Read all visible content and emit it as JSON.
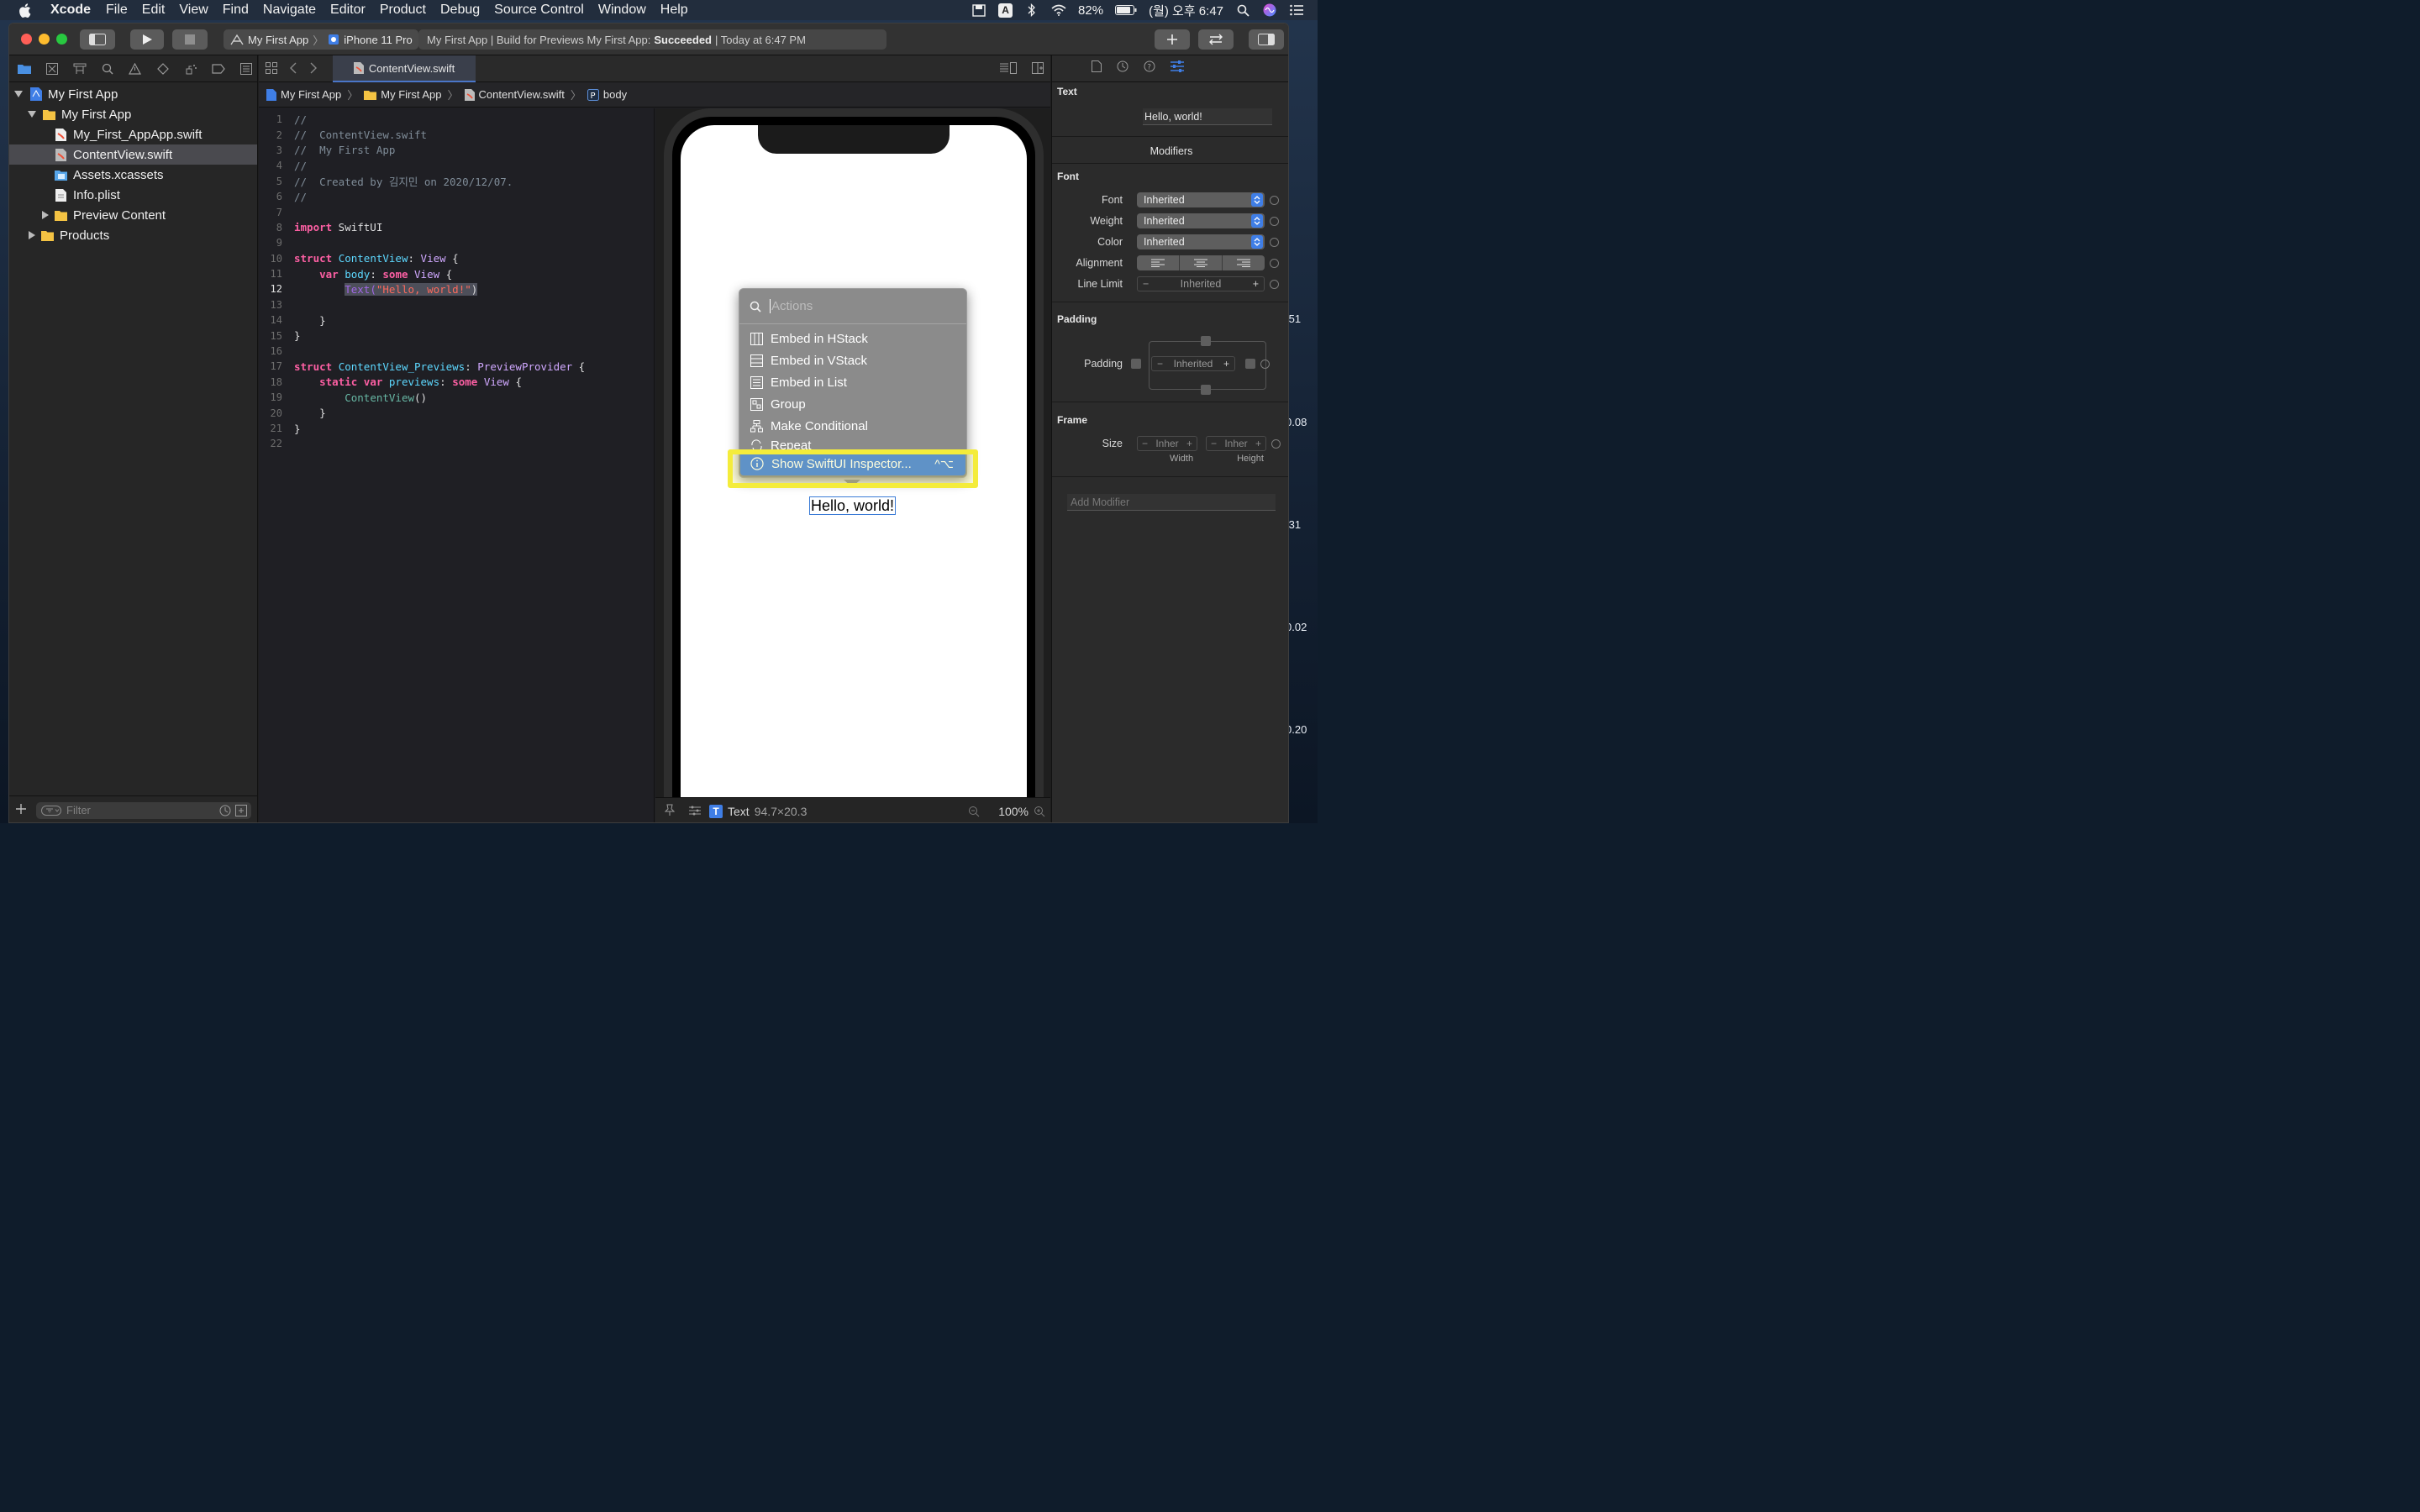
{
  "menubar": {
    "app_name": "Xcode",
    "items": [
      "File",
      "Edit",
      "View",
      "Find",
      "Navigate",
      "Editor",
      "Product",
      "Debug",
      "Source Control",
      "Window",
      "Help"
    ],
    "battery": "82%",
    "clock": "(월) 오후 6:47",
    "input_badge": "A"
  },
  "toolbar": {
    "scheme_name": "My First App",
    "device_name": "iPhone 11 Pro",
    "status_prefix": "My First App | Build for Previews My First App:",
    "status_result": "Succeeded",
    "status_time": "| Today at 6:47 PM"
  },
  "navigator": {
    "tree": [
      {
        "label": "My First App",
        "kind": "project"
      },
      {
        "label": "My First App",
        "kind": "folder"
      },
      {
        "label": "My_First_AppApp.swift",
        "kind": "swift"
      },
      {
        "label": "ContentView.swift",
        "kind": "swift",
        "selected": true
      },
      {
        "label": "Assets.xcassets",
        "kind": "assets"
      },
      {
        "label": "Info.plist",
        "kind": "plist"
      },
      {
        "label": "Preview Content",
        "kind": "folder"
      },
      {
        "label": "Products",
        "kind": "folder"
      }
    ],
    "filter_placeholder": "Filter"
  },
  "editor": {
    "tab_label": "ContentView.swift",
    "jumpbar": [
      "My First App",
      "My First App",
      "ContentView.swift",
      "body"
    ],
    "code_lines": [
      {
        "n": "1",
        "tokens": [
          [
            "c",
            "//"
          ]
        ]
      },
      {
        "n": "2",
        "tokens": [
          [
            "c",
            "//  ContentView.swift"
          ]
        ]
      },
      {
        "n": "3",
        "tokens": [
          [
            "c",
            "//  My First App"
          ]
        ]
      },
      {
        "n": "4",
        "tokens": [
          [
            "c",
            "//"
          ]
        ]
      },
      {
        "n": "5",
        "tokens": [
          [
            "c",
            "//  Created by 김지민 on 2020/12/07."
          ]
        ]
      },
      {
        "n": "6",
        "tokens": [
          [
            "c",
            "//"
          ]
        ]
      },
      {
        "n": "7",
        "tokens": []
      },
      {
        "n": "8",
        "tokens": [
          [
            "k",
            "import"
          ],
          [
            "d",
            " SwiftUI"
          ]
        ]
      },
      {
        "n": "9",
        "tokens": []
      },
      {
        "n": "10",
        "tokens": [
          [
            "k",
            "struct"
          ],
          [
            "d",
            " "
          ],
          [
            "t",
            "ContentView"
          ],
          [
            "d",
            ": "
          ],
          [
            "p",
            "View"
          ],
          [
            "d",
            " {"
          ]
        ]
      },
      {
        "n": "11",
        "tokens": [
          [
            "d",
            "    "
          ],
          [
            "k",
            "var"
          ],
          [
            "d",
            " "
          ],
          [
            "t",
            "body"
          ],
          [
            "d",
            ": "
          ],
          [
            "k",
            "some"
          ],
          [
            "d",
            " "
          ],
          [
            "p",
            "View"
          ],
          [
            "d",
            " {"
          ]
        ]
      },
      {
        "n": "12",
        "tokens": [
          [
            "d",
            "        "
          ],
          [
            "hlp",
            "Text("
          ],
          [
            "hls",
            "\"Hello, world!\""
          ],
          [
            "hld",
            ")"
          ]
        ],
        "current": true
      },
      {
        "n": "13",
        "tokens": []
      },
      {
        "n": "14",
        "tokens": [
          [
            "d",
            "    }"
          ]
        ]
      },
      {
        "n": "15",
        "tokens": [
          [
            "d",
            "}"
          ]
        ]
      },
      {
        "n": "16",
        "tokens": []
      },
      {
        "n": "17",
        "tokens": [
          [
            "k",
            "struct"
          ],
          [
            "d",
            " "
          ],
          [
            "t",
            "ContentView_Previews"
          ],
          [
            "d",
            ": "
          ],
          [
            "p",
            "PreviewProvider"
          ],
          [
            "d",
            " {"
          ]
        ]
      },
      {
        "n": "18",
        "tokens": [
          [
            "d",
            "    "
          ],
          [
            "k",
            "static"
          ],
          [
            "d",
            " "
          ],
          [
            "k",
            "var"
          ],
          [
            "d",
            " "
          ],
          [
            "t",
            "previews"
          ],
          [
            "d",
            ": "
          ],
          [
            "k",
            "some"
          ],
          [
            "d",
            " "
          ],
          [
            "p",
            "View"
          ],
          [
            "d",
            " {"
          ]
        ]
      },
      {
        "n": "19",
        "tokens": [
          [
            "d",
            "        "
          ],
          [
            "v",
            "ContentView"
          ],
          [
            "d",
            "()"
          ]
        ]
      },
      {
        "n": "20",
        "tokens": [
          [
            "d",
            "    }"
          ]
        ]
      },
      {
        "n": "21",
        "tokens": [
          [
            "d",
            "}"
          ]
        ]
      },
      {
        "n": "22",
        "tokens": []
      }
    ]
  },
  "preview": {
    "hello_text": "Hello, world!",
    "selection_type": "Text",
    "selection_size": "94.7×20.3",
    "zoom": "100%"
  },
  "popup": {
    "search_placeholder": "Actions",
    "items": [
      {
        "label": "Embed in HStack",
        "icon": "hstack-icon"
      },
      {
        "label": "Embed in VStack",
        "icon": "vstack-icon"
      },
      {
        "label": "Embed in List",
        "icon": "list-icon"
      },
      {
        "label": "Group",
        "icon": "group-icon"
      },
      {
        "label": "Make Conditional",
        "icon": "conditional-icon"
      },
      {
        "label": "Repeat",
        "icon": "repeat-icon"
      }
    ],
    "active_item": {
      "label": "Show SwiftUI Inspector...",
      "shortcut": "^⌥"
    }
  },
  "inspector": {
    "text_section": "Text",
    "text_value": "Hello, world!",
    "modifiers_header": "Modifiers",
    "font_section": "Font",
    "font_label": "Font",
    "font_value": "Inherited",
    "weight_label": "Weight",
    "weight_value": "Inherited",
    "color_label": "Color",
    "color_value": "Inherited",
    "alignment_label": "Alignment",
    "line_limit_label": "Line Limit",
    "line_limit_value": "Inherited",
    "padding_section": "Padding",
    "padding_label": "Padding",
    "padding_value": "Inherited",
    "frame_section": "Frame",
    "size_label": "Size",
    "width_value": "Inher",
    "height_value": "Inher",
    "width_label": "Width",
    "height_label": "Height",
    "add_modifier_placeholder": "Add Modifier"
  },
  "wallpaper_numbers": [
    ".51",
    "0.08",
    ".31",
    "0.02",
    "0.20"
  ],
  "colors": {
    "accent": "#3f7ee6",
    "highlight": "#f4ec3b",
    "keyword": "#fc5fa3",
    "type": "#5dd8ff",
    "string": "#fc6a5d"
  }
}
